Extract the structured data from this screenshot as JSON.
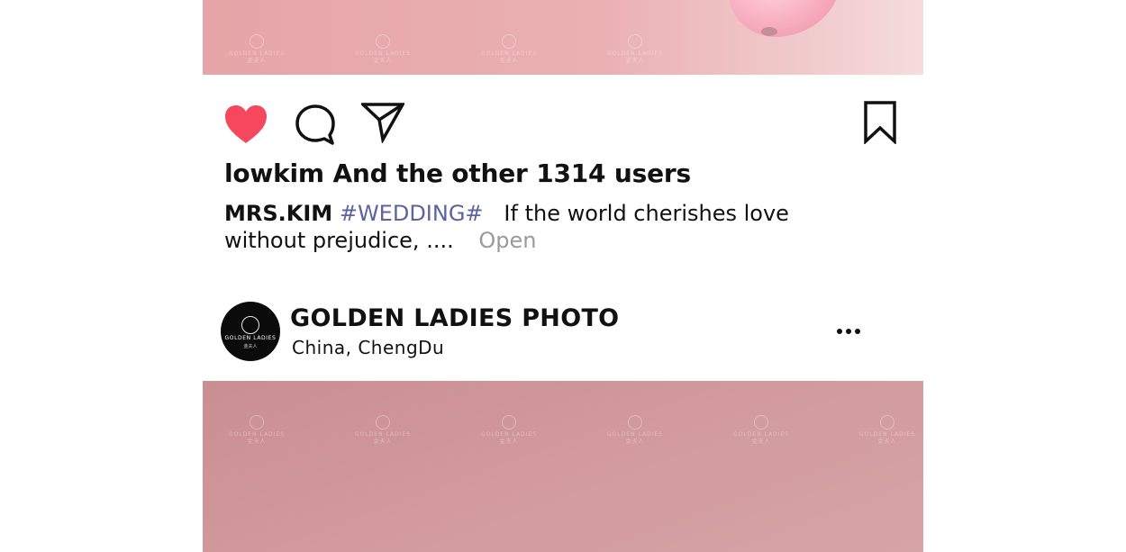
{
  "post_top": {
    "watermark": {
      "line1": "GOLDEN LADIES",
      "line2": "金夫人"
    }
  },
  "actions": {
    "like_icon": "heart-icon",
    "comment_icon": "comment-icon",
    "share_icon": "send-icon",
    "save_icon": "bookmark-icon",
    "like_color": "#f5475d"
  },
  "likes_text": "lowkim And the other 1314 users",
  "caption": {
    "username": "MRS.KIM",
    "hashtag": "#WEDDING#",
    "text": "If the world cherishes love without prejudice, ....",
    "open_label": "Open"
  },
  "next_post": {
    "avatar": {
      "line1": "GOLDEN LADIES",
      "line2": "金夫人"
    },
    "account_name": "GOLDEN LADIES PHOTO",
    "location": "China,  ChengDu",
    "more_icon": "more-horizontal-icon"
  }
}
